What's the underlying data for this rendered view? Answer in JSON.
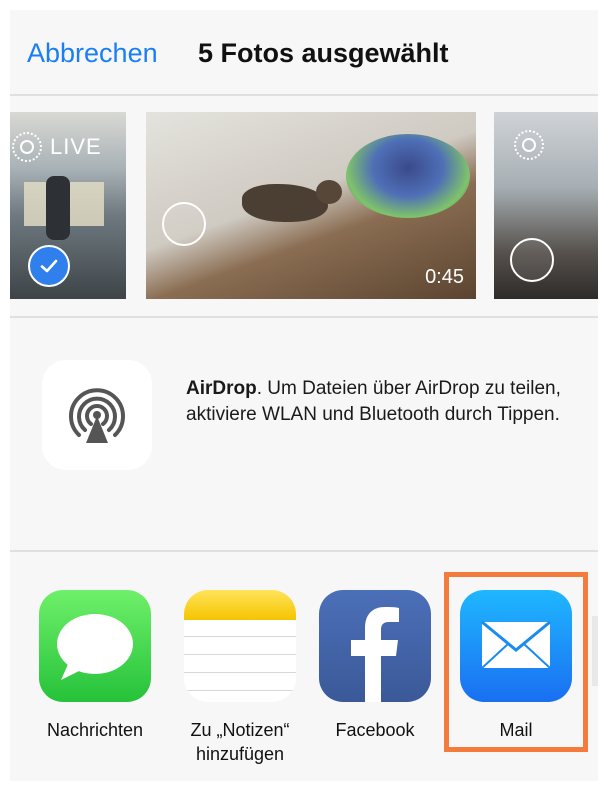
{
  "header": {
    "cancel_label": "Abbrechen",
    "title": "5 Fotos ausgewählt"
  },
  "photos": [
    {
      "live_label": "LIVE",
      "selected": true
    },
    {
      "duration": "0:45",
      "selected": false
    },
    {
      "selected": false
    }
  ],
  "airdrop": {
    "title": "AirDrop",
    "description": ". Um Dateien über AirDrop zu teilen, aktiviere WLAN und Bluetooth durch Tippen."
  },
  "share_apps": [
    {
      "label": "Nachrichten",
      "icon": "messages-icon"
    },
    {
      "label": "Zu „Notizen“ hinzufügen",
      "icon": "notes-icon"
    },
    {
      "label": "Facebook",
      "icon": "facebook-icon"
    },
    {
      "label": "Mail",
      "icon": "mail-icon"
    }
  ],
  "colors": {
    "accent": "#1a7ff5",
    "highlight": "#f47b3b",
    "selection": "#2f80ed"
  }
}
